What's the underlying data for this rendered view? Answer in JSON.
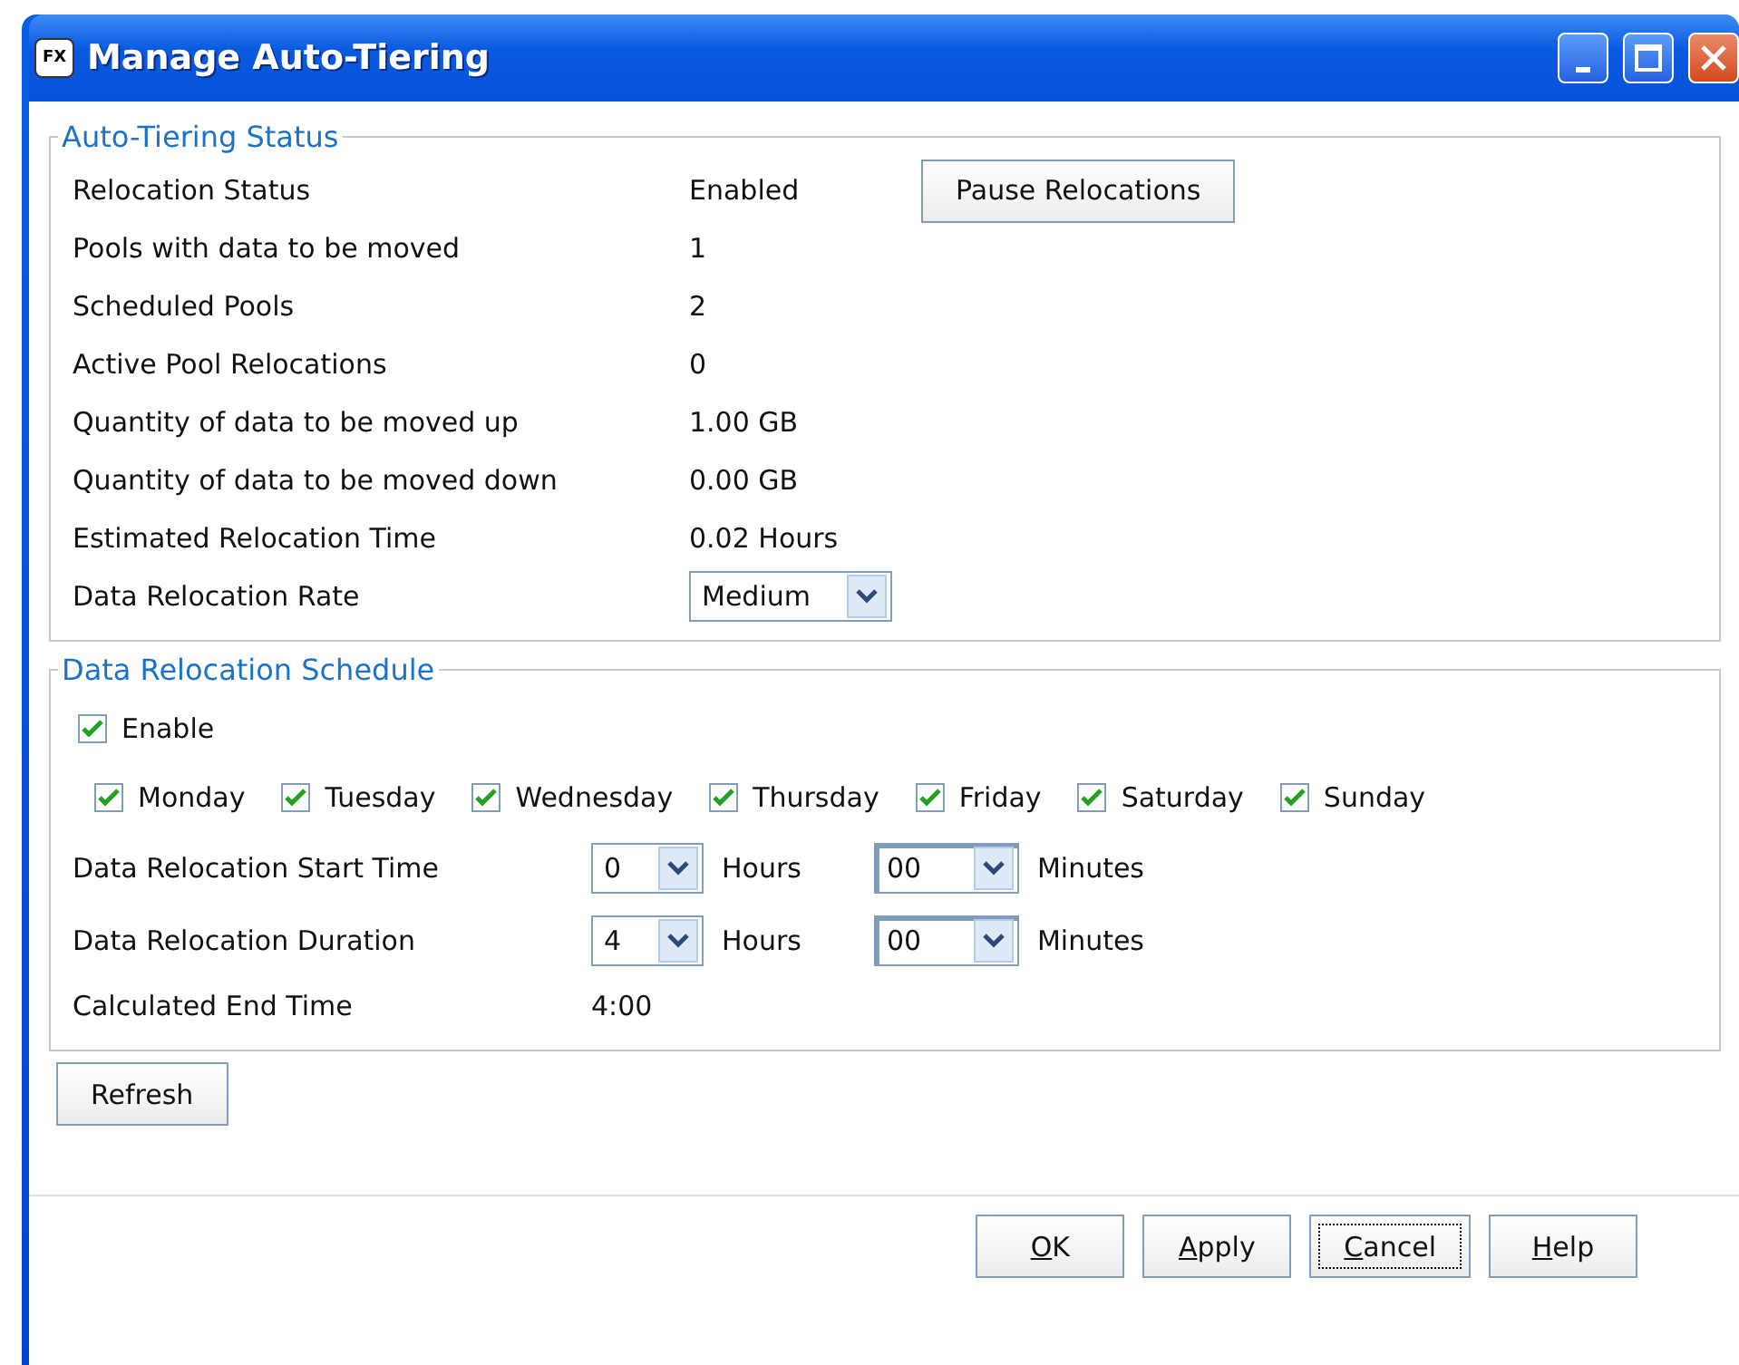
{
  "window": {
    "title": "Manage Auto-Tiering",
    "app_badge": "FX"
  },
  "status": {
    "title": "Auto-Tiering Status",
    "rows": [
      {
        "label": "Relocation Status",
        "value": "Enabled",
        "kind": "text",
        "button": "Pause Relocations"
      },
      {
        "label": "Pools with data to be moved",
        "value": "1",
        "kind": "text"
      },
      {
        "label": "Scheduled Pools",
        "value": "2",
        "kind": "text"
      },
      {
        "label": "Active Pool Relocations",
        "value": "0",
        "kind": "text"
      },
      {
        "label": "Quantity of data to be moved up",
        "value": "1.00 GB",
        "kind": "text"
      },
      {
        "label": "Quantity of data to be moved down",
        "value": "0.00 GB",
        "kind": "text"
      },
      {
        "label": "Estimated Relocation Time",
        "value": "0.02 Hours",
        "kind": "text"
      },
      {
        "label": "Data Relocation Rate",
        "value": "Medium",
        "kind": "select"
      }
    ]
  },
  "schedule": {
    "title": "Data Relocation Schedule",
    "enable": {
      "label": "Enable",
      "checked": true
    },
    "days": [
      {
        "label": "Monday",
        "checked": true
      },
      {
        "label": "Tuesday",
        "checked": true
      },
      {
        "label": "Wednesday",
        "checked": true
      },
      {
        "label": "Thursday",
        "checked": true
      },
      {
        "label": "Friday",
        "checked": true
      },
      {
        "label": "Saturday",
        "checked": true
      },
      {
        "label": "Sunday",
        "checked": true
      }
    ],
    "times": [
      {
        "label": "Data Relocation Start Time",
        "hours": "0",
        "hours_unit": "Hours",
        "minutes": "00",
        "minutes_unit": "Minutes"
      },
      {
        "label": "Data Relocation Duration",
        "hours": "4",
        "hours_unit": "Hours",
        "minutes": "00",
        "minutes_unit": "Minutes"
      }
    ],
    "end": {
      "label": "Calculated End Time",
      "value": "4:00"
    }
  },
  "refresh": "Refresh",
  "buttons": [
    {
      "label": "OK",
      "focused": false
    },
    {
      "label": "Apply",
      "focused": false
    },
    {
      "label": "Cancel",
      "focused": true
    },
    {
      "label": "Help",
      "focused": false
    }
  ]
}
